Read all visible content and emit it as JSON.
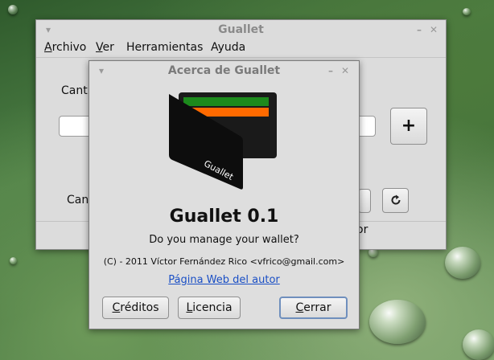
{
  "main_window": {
    "title": "Guallet",
    "menu": [
      {
        "mnemonic": "A",
        "rest": "rchivo"
      },
      {
        "mnemonic": "V",
        "rest": "er"
      },
      {
        "mnemonic": "",
        "rest": "Herramientas"
      },
      {
        "mnemonic": "",
        "rest": "Ayuda"
      }
    ],
    "label_top": "Canti",
    "label_bottom": "Cant",
    "add_label": "+",
    "reset_icon": "refresh-icon",
    "partial_text": "or"
  },
  "about_dialog": {
    "title": "Acerca de Guallet",
    "logo_text": "Guallet",
    "logo_colors": {
      "stripe_green": "#1c8a1c",
      "stripe_orange": "#ff6a00",
      "wallet": "#1a1a1a"
    },
    "app_name": "Guallet 0.1",
    "comment": "Do you manage your wallet?",
    "copyright": "(C) - 2011 Víctor Fernández Rico <vfrico@gmail.com>",
    "website_label": "Página Web del autor",
    "buttons": {
      "credits": {
        "mnemonic": "C",
        "rest": "réditos"
      },
      "license": {
        "mnemonic": "L",
        "rest": "icencia"
      },
      "close": {
        "mnemonic": "C",
        "rest": "errar"
      }
    }
  }
}
